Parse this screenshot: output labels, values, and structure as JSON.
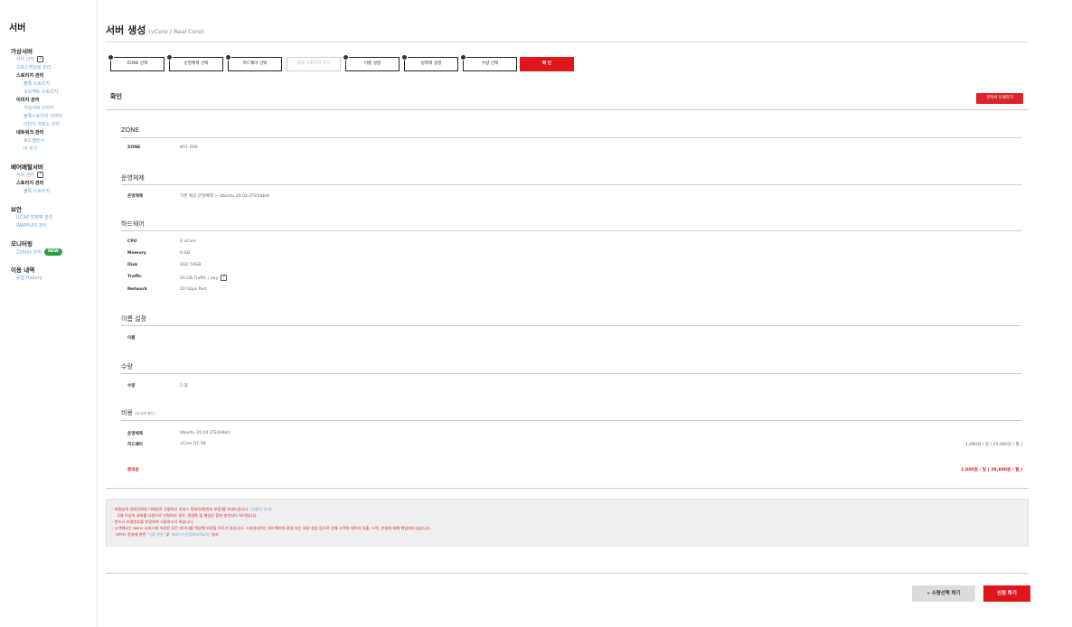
{
  "sidebar": {
    "title": "서버",
    "virtual_server": "가상서버",
    "server_mgmt": "서버 관리",
    "autoscaling": "오토스케일링 관리",
    "storage_mgmt": "스토리지 관리",
    "block_storage": "블록 스토리지",
    "object_storage": "오브젝트 스토리지",
    "image_mgmt": "이미지 관리",
    "vserver_image": "가상서버 이미지",
    "block_image": "블록스토리지 이미지",
    "image_store": "이미지 저장소 관리",
    "network_mgmt": "네트워크 관리",
    "lb": "로드밸런서",
    "ip_add": "IP 추가",
    "baremetal": "베어메탈서버",
    "bm_server_mgmt": "서버 관리",
    "bm_storage": "스토리지 관리",
    "bm_block": "블록 스토리지",
    "security": "보안",
    "ilcap": "ILCAP 방화벽 관리",
    "wapples": "WAPPLES 관리",
    "monitoring": "모니터링",
    "zabbix": "Zabbix 관리",
    "new_badge": "NEW",
    "history_title": "이용 내역",
    "history_link": "동접 History",
    "q_icon": "?"
  },
  "header": {
    "title": "서버 생성",
    "subtitle": "(vCore / Real Core)"
  },
  "steps": [
    {
      "label": "ZONE 선택"
    },
    {
      "label": "운영체제 선택"
    },
    {
      "label": "하드웨어 선택"
    },
    {
      "label": "블록 스토리지 추가"
    },
    {
      "label": "이름 설정"
    },
    {
      "label": "방화벽 설정"
    },
    {
      "label": "수량 선택"
    },
    {
      "label": "확 인"
    }
  ],
  "confirm": {
    "title": "확인",
    "print_btn": "견적서 인쇄하기"
  },
  "zone": {
    "title": "ZONE",
    "label": "ZONE",
    "value": "KR1-Z06"
  },
  "os": {
    "title": "운영체제",
    "label": "운영체제",
    "value": "기본 제공 운영체제 > Ubuntu 20.04 LTS(64bit)"
  },
  "hardware": {
    "title": "하드웨어",
    "rows": [
      {
        "label": "CPU",
        "value": "2 vCore"
      },
      {
        "label": "Memory",
        "value": "6 GB"
      },
      {
        "label": "Disk",
        "value": "SSD 50GB"
      },
      {
        "label": "Traffic",
        "value": "20 GB Traffic / day"
      },
      {
        "label": "Network",
        "value": "10 Gbps Port"
      }
    ]
  },
  "name": {
    "title": "이름 설정",
    "label": "이름",
    "value": ""
  },
  "qty": {
    "title": "수량",
    "label": "수량",
    "value": "1 대"
  },
  "cost": {
    "title": "비용",
    "title_small": "(부가세 별도)",
    "os_label": "운영체제",
    "os_value": "Ubuntu 20.04 LTS(64bit)",
    "hw_label": "하드웨어",
    "hw_value": "vCore.Q1-58",
    "hw_price": "1,080원 / 일 ( 29,880원 / 월 )",
    "total_label": "총비용",
    "total_price": "1,080원 / 일 ( 29,880원 / 월 )"
  },
  "notice": {
    "line1a": "- 회원님의 휴대전화와 이메일로 신청하신 서비스 정보(비밀번호 포함)를 보내드립니다.",
    "line1b": "(사용자 추가)",
    "line2": "2대 이상의 서버를 다량으로 신청하신 경우, 알림톡 및 메일은 합쳐 발송되어 처리됩니다.",
    "line3": "- 반드시 비밀번호를 변경하여 사용하시기 바랍니다.",
    "line4": "- 고객께서는 Iwinv 서비스에 저장된 모든 데이터를 백업해 보관할 의무가 있습니다. 스마일서브는 하드웨어의 장실 또는 외부 침입 등으로 인해 고객의 데이터 유출, 누락, 손실에 대해 책임지지 않습니다.",
    "line5a": "데이터 장실에 관한",
    "line5b": "'이용 약관'",
    "line5c": "및",
    "line5d": "'서비스수준협약서(SLA)'",
    "line5e": "참조"
  },
  "footer": {
    "prev_btn": "« 수량선택 하기",
    "submit_btn": "신청 하기"
  }
}
